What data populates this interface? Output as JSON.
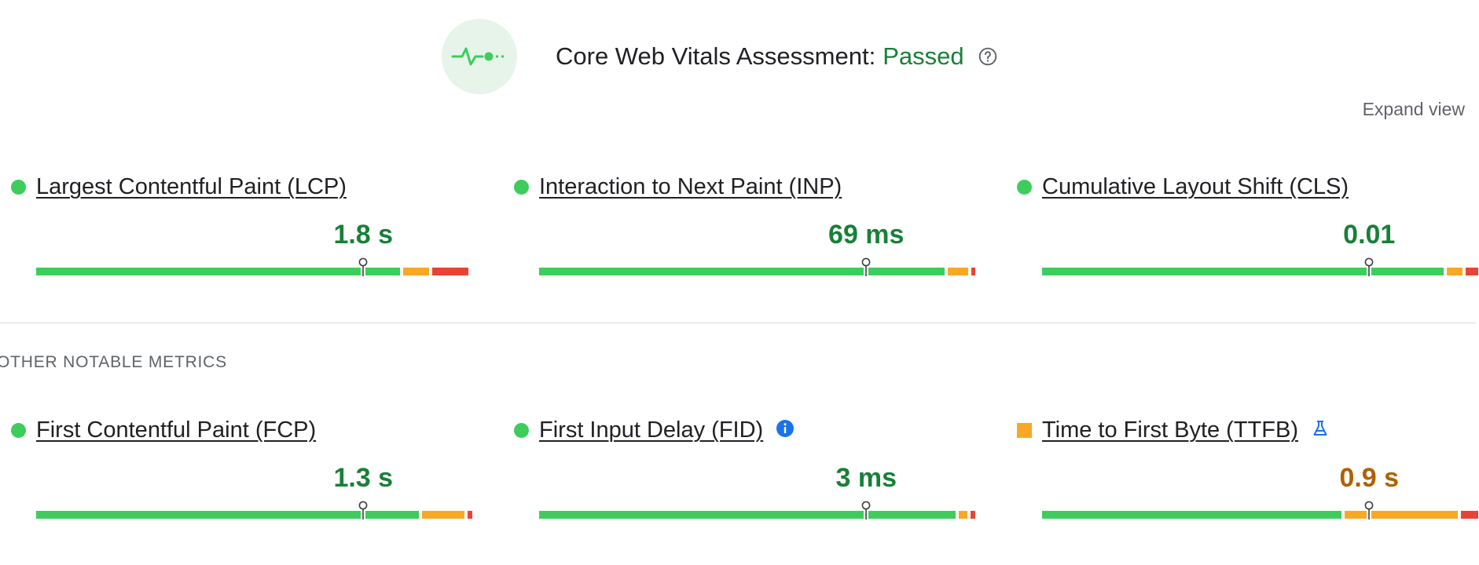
{
  "header": {
    "title": "Core Web Vitals Assessment:",
    "status": "Passed",
    "status_color": "#188038",
    "icon": "pulse-icon",
    "help_icon": "help-circle-icon"
  },
  "expand_view": "Expand view",
  "section_label": "OTHER NOTABLE METRICS",
  "colors": {
    "good": "#3dcd5c",
    "needs_improvement": "#f9a825",
    "poor": "#ea4335",
    "good_text": "#188038",
    "ni_text": "#b06000"
  },
  "core_metrics": [
    {
      "title": "Largest Contentful Paint (LCP)",
      "value": "1.8 s",
      "rating": "good",
      "distribution": {
        "good": 0.847,
        "needs_improvement": 0.059,
        "poor": 0.084
      },
      "marker": 0.75
    },
    {
      "title": "Interaction to Next Paint (INP)",
      "value": "69 ms",
      "rating": "good",
      "distribution": {
        "good": 0.944,
        "needs_improvement": 0.046,
        "poor": 0.01
      },
      "marker": 0.75
    },
    {
      "title": "Cumulative Layout Shift (CLS)",
      "value": "0.01",
      "rating": "good",
      "distribution": {
        "good": 0.934,
        "needs_improvement": 0.036,
        "poor": 0.03
      },
      "marker": 0.75
    }
  ],
  "other_metrics": [
    {
      "title": "First Contentful Paint (FCP)",
      "value": "1.3 s",
      "rating": "good",
      "distribution": {
        "good": 0.891,
        "needs_improvement": 0.098,
        "poor": 0.011
      },
      "marker": 0.75,
      "extra_icon": ""
    },
    {
      "title": "First Input Delay (FID)",
      "value": "3 ms",
      "rating": "good",
      "distribution": {
        "good": 0.969,
        "needs_improvement": 0.02,
        "poor": 0.011
      },
      "marker": 0.75,
      "extra_icon": "info-icon"
    },
    {
      "title": "Time to First Byte (TTFB)",
      "value": "0.9 s",
      "rating": "needs_improvement",
      "distribution": {
        "good": 0.697,
        "needs_improvement": 0.263,
        "poor": 0.04
      },
      "marker": 0.75,
      "extra_icon": "lab-flask-icon"
    }
  ]
}
